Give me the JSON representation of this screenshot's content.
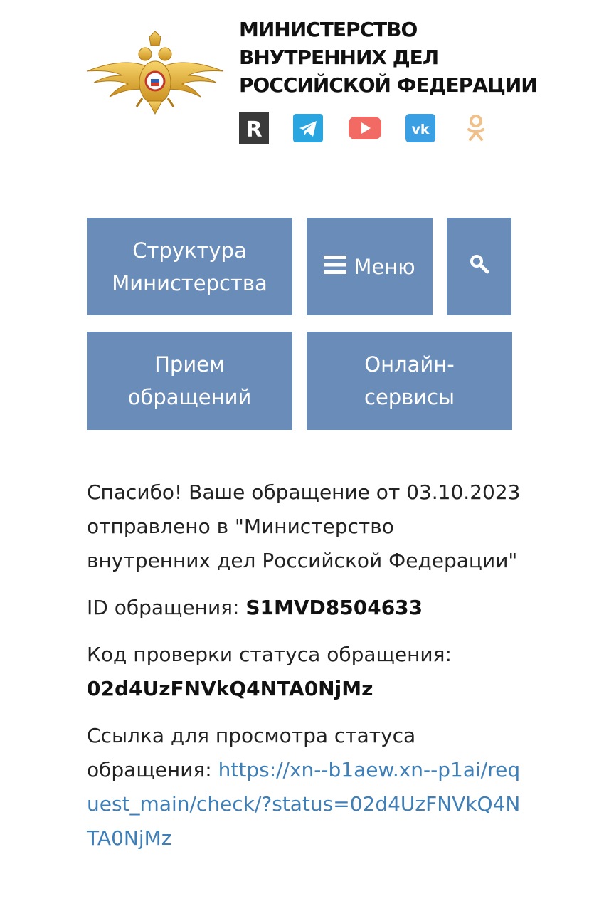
{
  "header": {
    "title_lines": [
      "МИНИСТЕРСТВО",
      "ВНУТРЕННИХ ДЕЛ",
      "РОССИЙСКОЙ ФЕДЕРАЦИИ"
    ],
    "emblem_icon": "double-headed-eagle-emblem",
    "emblem_color": "#e3b23c",
    "social_icons": [
      {
        "name": "rutube-icon",
        "glyph": "R",
        "color": "#3a3a3a"
      },
      {
        "name": "telegram-icon",
        "color": "#2aa5e0"
      },
      {
        "name": "youtube-icon",
        "color": "#f26a64"
      },
      {
        "name": "vk-icon",
        "glyph": "vk",
        "color": "#3b9fe3"
      },
      {
        "name": "odnoklassniki-icon",
        "color": "#f0c08a"
      }
    ]
  },
  "nav": {
    "structure_line1": "Структура",
    "structure_line2": "Министерства",
    "menu_label": "Меню",
    "reception_line1": "Прием",
    "reception_line2": "обращений",
    "online_line1": "Онлайн-",
    "online_line2": "сервисы",
    "button_color": "#6a8cb9"
  },
  "content": {
    "thanks_text": "Спасибо! Ваше обращение от 03.10.2023 отправлено в \"Министерство внутренних дел Российской Федерации\"",
    "id_label": "ID обращения: ",
    "id_value": "S1MVD8504633",
    "code_label": "Код проверки статуса обращения:",
    "code_value": "02d4UzFNVkQ4NTA0NjMz",
    "link_label": "Ссылка для просмотра статуса обращения: ",
    "link_text": "https://xn--b1aew.xn--p1ai/request_main/check/?status=02d4UzFNVkQ4NTA0NjMz",
    "link_color": "#3f7fb8"
  }
}
